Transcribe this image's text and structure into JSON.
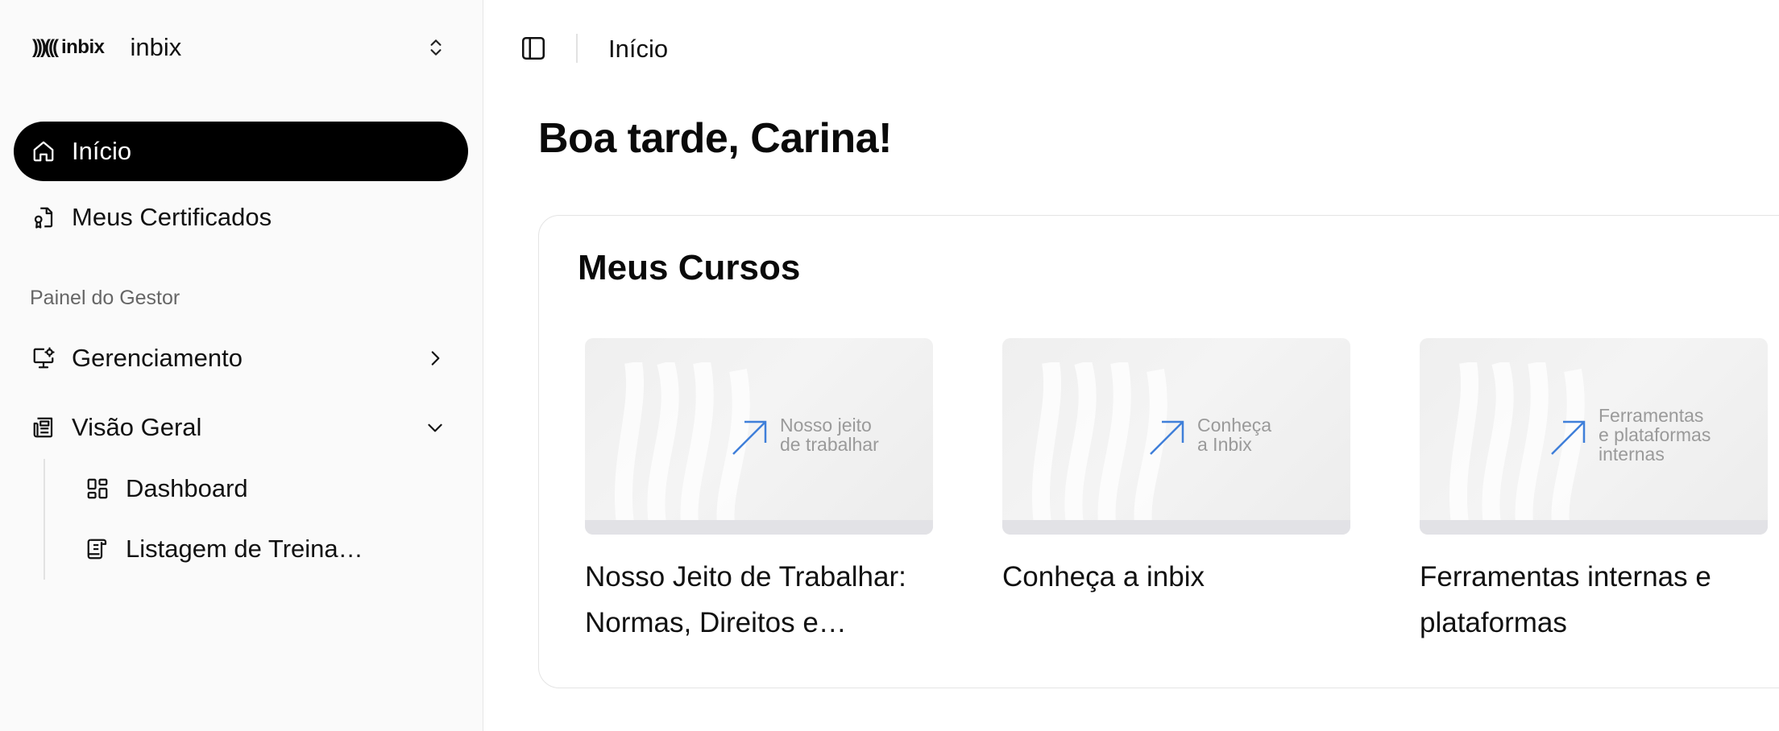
{
  "brand": {
    "logo_text": "inbix",
    "logo_waves": ")))((( ",
    "name": "inbix"
  },
  "sidebar": {
    "items": [
      {
        "label": "Início",
        "icon": "home-icon",
        "active": true
      },
      {
        "label": "Meus Certificados",
        "icon": "certificate-icon",
        "active": false
      }
    ],
    "section_label": "Painel do Gestor",
    "manager_items": [
      {
        "label": "Gerenciamento",
        "icon": "monitor-settings-icon",
        "chevron": "chevron-right-icon"
      },
      {
        "label": "Visão Geral",
        "icon": "newspaper-icon",
        "chevron": "chevron-down-icon"
      }
    ],
    "sub_items": [
      {
        "label": "Dashboard",
        "icon": "dashboard-grid-icon"
      },
      {
        "label": "Listagem de Treina…",
        "icon": "scroll-list-icon"
      }
    ]
  },
  "topbar": {
    "breadcrumb": "Início"
  },
  "main": {
    "greeting": "Boa tarde, Carina!",
    "courses_title": "Meus Cursos",
    "courses": [
      {
        "thumb_text": "Nosso jeito\nde trabalhar",
        "title": "Nosso Jeito de Trabalhar: Normas, Direitos e…"
      },
      {
        "thumb_text": "Conheça\na Inbix",
        "title": "Conheça a inbix"
      },
      {
        "thumb_text": "Ferramentas\ne plataformas\ninternas",
        "title": "Ferramentas internas e plataformas"
      }
    ]
  },
  "colors": {
    "accent": "#000000",
    "arrow_blue": "#3f7fd9",
    "sidebar_bg": "#fafafa"
  }
}
